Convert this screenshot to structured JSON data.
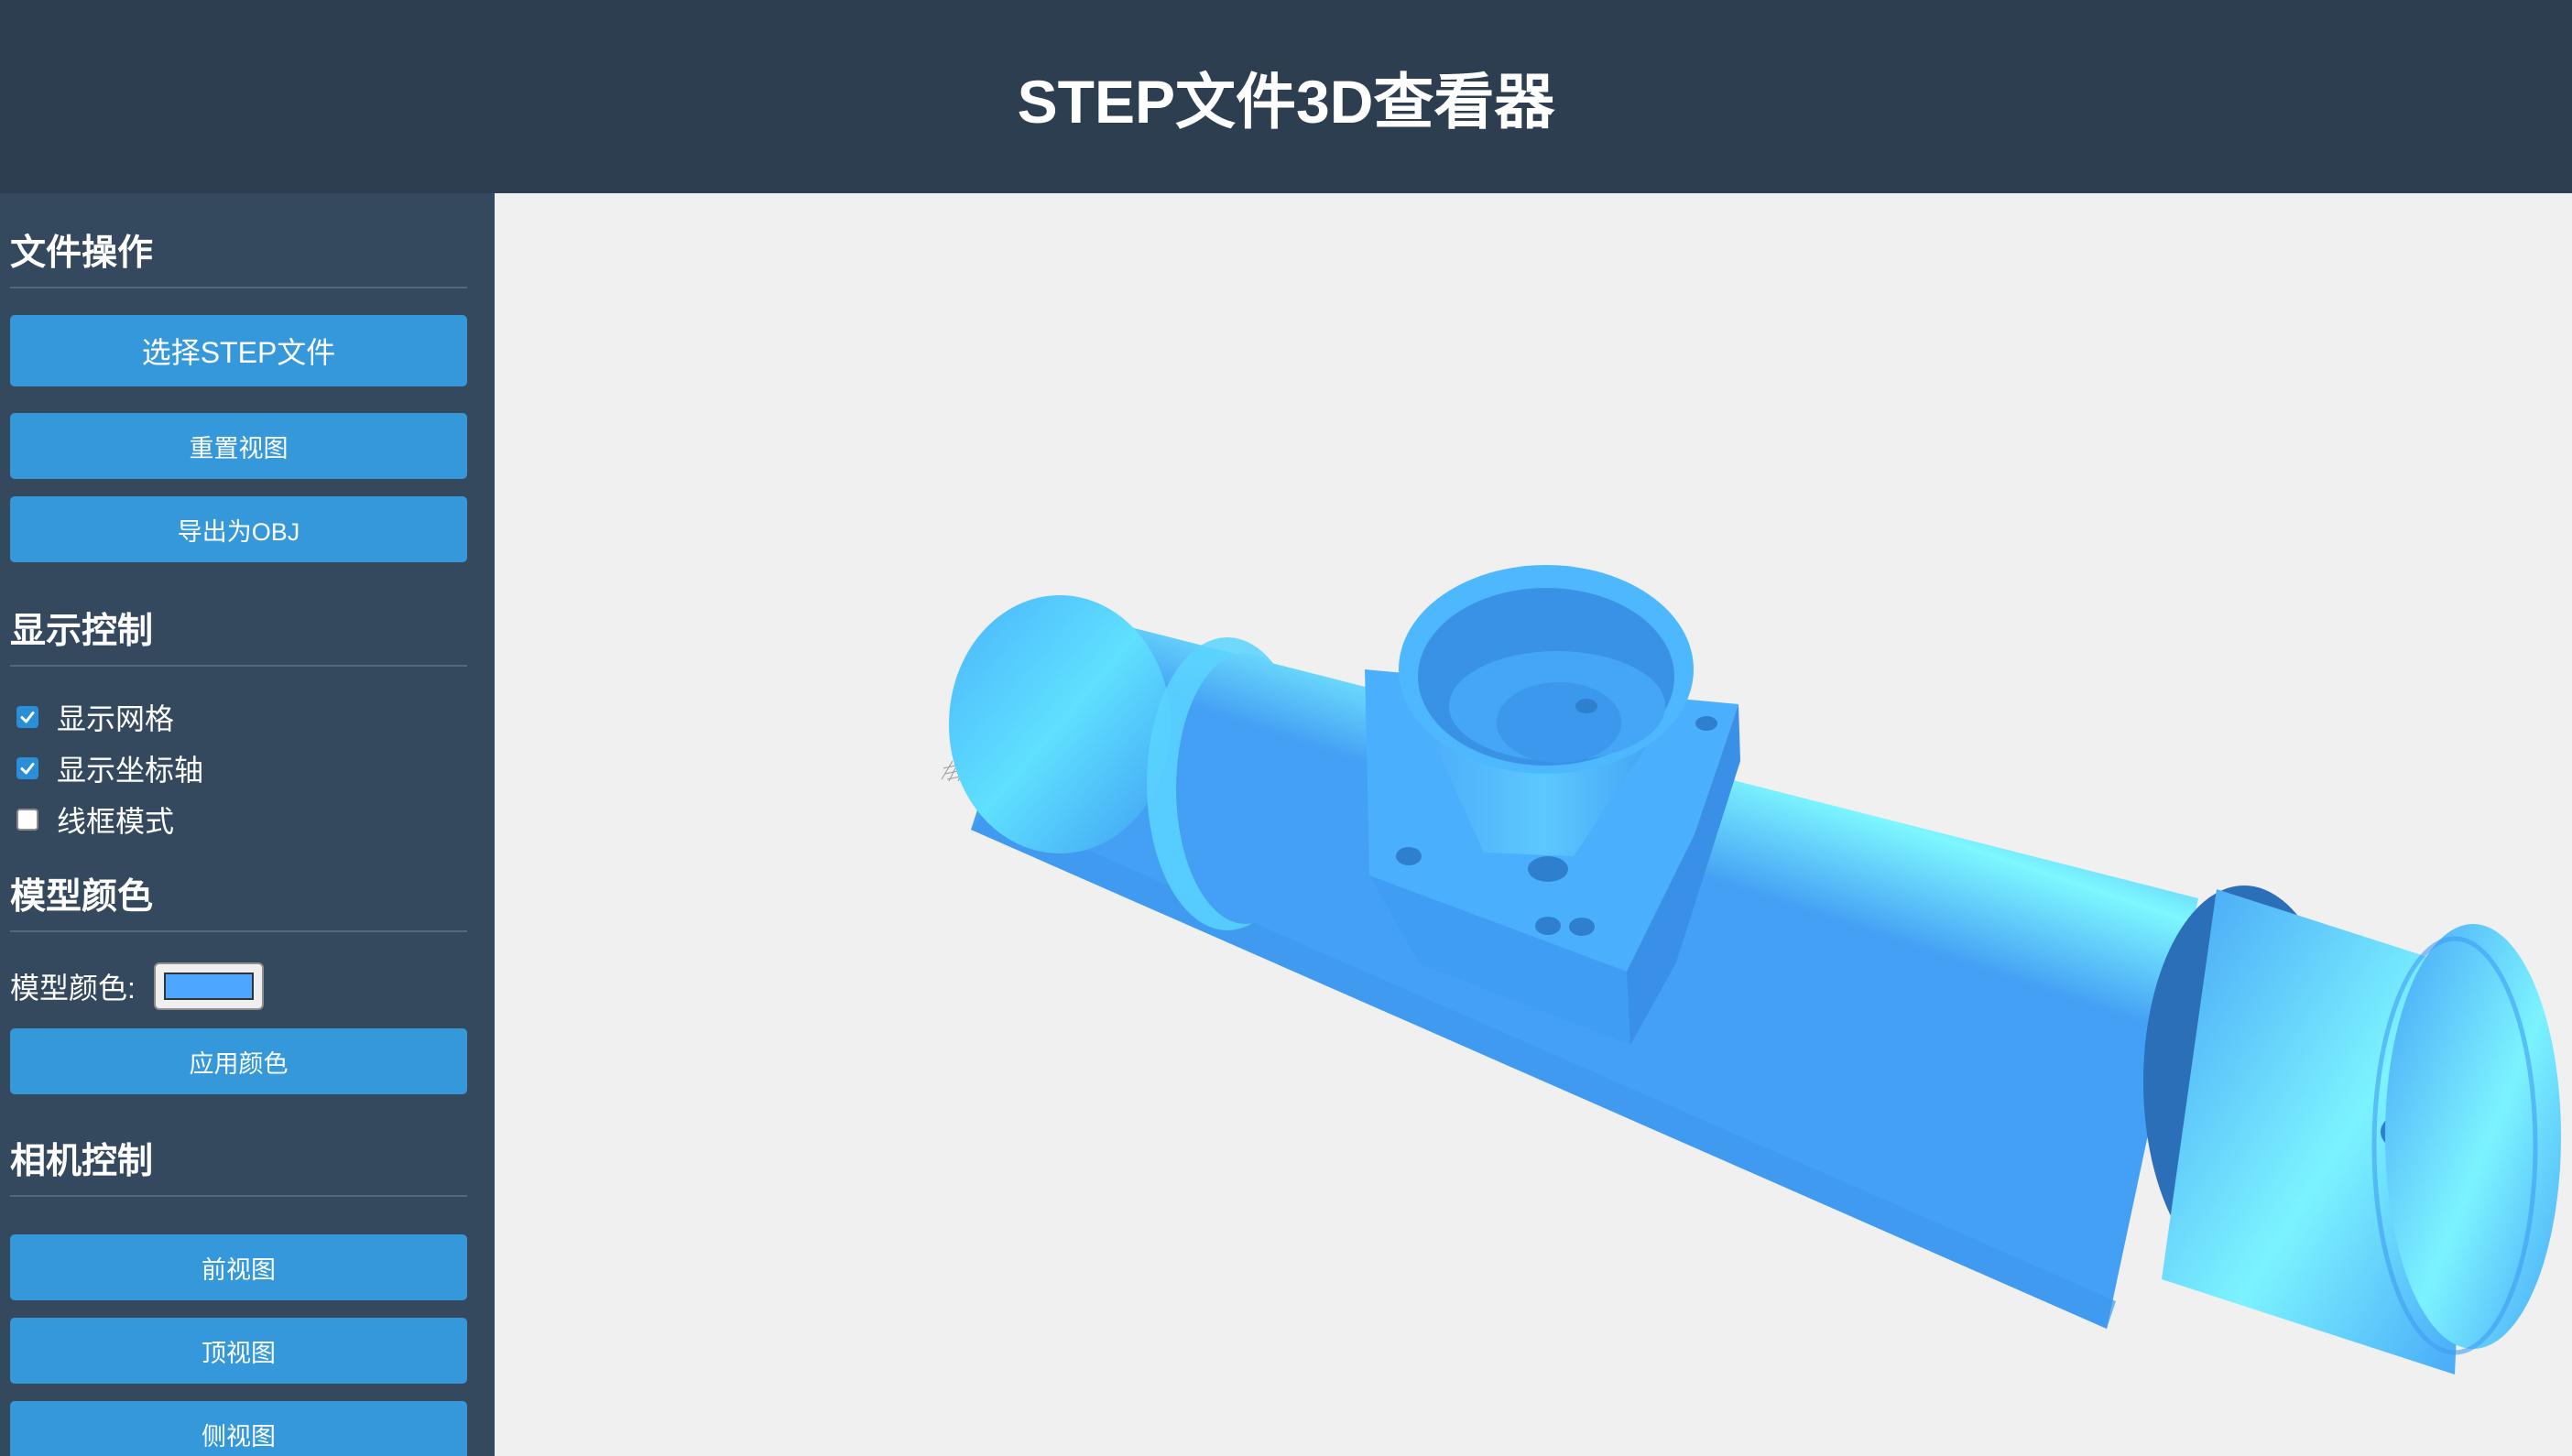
{
  "header": {
    "title": "STEP文件3D查看器"
  },
  "sidebar": {
    "file_ops": {
      "title": "文件操作",
      "select_button": "选择STEP文件",
      "reset_button": "重置视图",
      "export_button": "导出为OBJ"
    },
    "display": {
      "title": "显示控制",
      "options": [
        {
          "label": "显示网格",
          "checked": true
        },
        {
          "label": "显示坐标轴",
          "checked": true
        },
        {
          "label": "线框模式",
          "checked": false
        }
      ]
    },
    "color": {
      "title": "模型颜色",
      "label": "模型颜色:",
      "value": "#4da6ff",
      "apply_button": "应用颜色"
    },
    "camera": {
      "title": "相机控制",
      "front_button": "前视图",
      "top_button": "顶视图",
      "side_button": "侧视图"
    }
  },
  "colors": {
    "header_bg": "#2c3e50",
    "sidebar_bg": "#34495e",
    "button": "#3498db",
    "model": "#4da6ff",
    "viewport_bg": "#f0f0f0"
  }
}
